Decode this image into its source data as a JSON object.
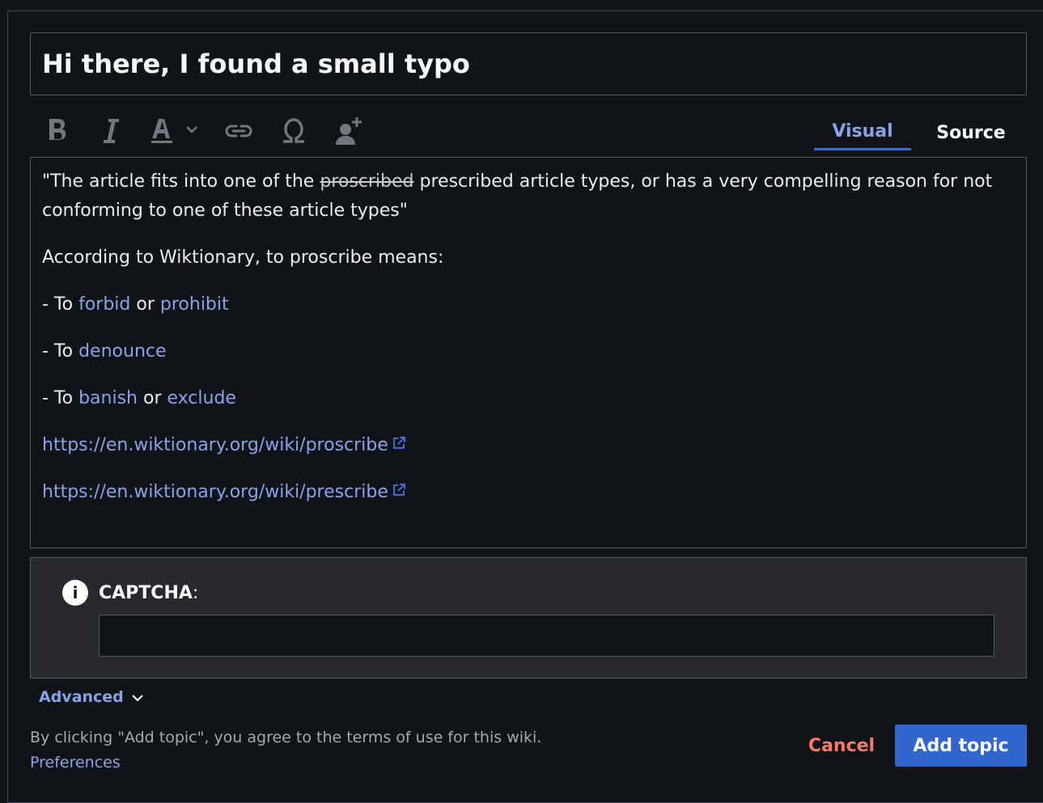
{
  "title_field": {
    "value": "Hi there, I found a small typo"
  },
  "toolbar": {
    "tools": [
      "bold-icon",
      "italic-icon",
      "text-style-icon",
      "link-icon",
      "special-character-icon",
      "mention-user-icon"
    ],
    "tabs": {
      "visual": "Visual",
      "source": "Source"
    }
  },
  "body": {
    "quote_open": "\"The article fits into one of the ",
    "struck_word": "proscribed",
    "quote_rest": " prescribed article types, or has a very compelling reason for not conforming to one of these article types\"",
    "line2": "According to Wiktionary, to proscribe means:",
    "list": [
      {
        "prefix": "- To ",
        "link1": "forbid",
        "mid": " or ",
        "link2": "prohibit"
      },
      {
        "prefix": "- To ",
        "link1": "denounce"
      },
      {
        "prefix": "- To ",
        "link1": "banish",
        "mid": " or ",
        "link2": "exclude"
      }
    ],
    "url1": "https://en.wiktionary.org/wiki/proscribe",
    "url2": "https://en.wiktionary.org/wiki/prescribe"
  },
  "captcha": {
    "label": "CAPTCHA",
    "colon": ":",
    "value": ""
  },
  "advanced": {
    "label": "Advanced"
  },
  "footer": {
    "terms": "By clicking \"Add topic\", you agree to the terms of use for this wiki.",
    "preferences": "Preferences",
    "cancel": "Cancel",
    "submit": "Add topic"
  },
  "colors": {
    "background": "#101418",
    "link": "#88a3e8",
    "primary_button": "#3366cc",
    "destructive": "#fd7865"
  }
}
